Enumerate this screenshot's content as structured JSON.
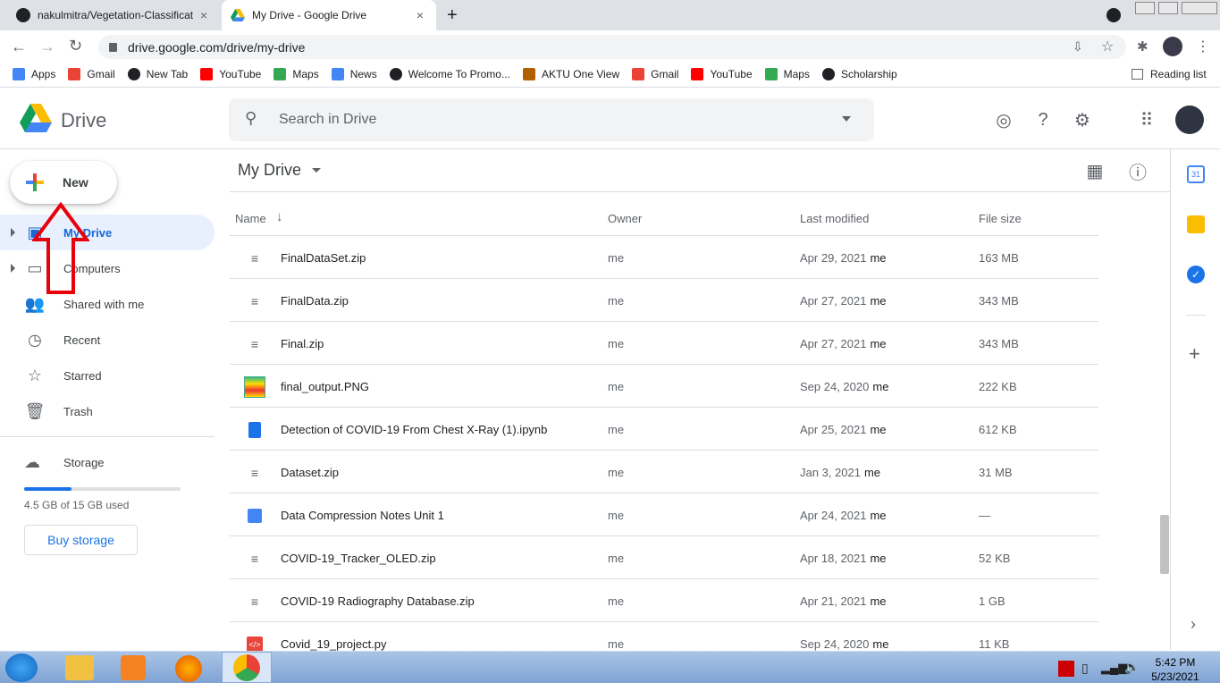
{
  "browser": {
    "tabs": [
      {
        "title": "nakulmitra/Vegetation-Classificat",
        "close": "×"
      },
      {
        "title": "My Drive - Google Drive",
        "close": "×"
      }
    ],
    "new_tab": "+",
    "url": "drive.google.com/drive/my-drive",
    "bookmarks": [
      {
        "label": "Apps",
        "icon": "apps-grid-icon",
        "color": "#4285f4"
      },
      {
        "label": "Gmail",
        "icon": "gmail-icon",
        "color": "#ea4335"
      },
      {
        "label": "New Tab",
        "icon": "globe-icon",
        "color": "#202124"
      },
      {
        "label": "YouTube",
        "icon": "youtube-icon",
        "color": "#ff0000"
      },
      {
        "label": "Maps",
        "icon": "maps-icon",
        "color": "#34a853"
      },
      {
        "label": "News",
        "icon": "news-icon",
        "color": "#4285f4"
      },
      {
        "label": "Welcome To Promo...",
        "icon": "globe-icon",
        "color": "#202124"
      },
      {
        "label": "AKTU One View",
        "icon": "aktu-icon",
        "color": "#b06000"
      },
      {
        "label": "Gmail",
        "icon": "gmail-icon",
        "color": "#ea4335"
      },
      {
        "label": "YouTube",
        "icon": "youtube-icon",
        "color": "#ff0000"
      },
      {
        "label": "Maps",
        "icon": "maps-icon",
        "color": "#34a853"
      },
      {
        "label": "Scholarship",
        "icon": "globe-icon",
        "color": "#202124"
      }
    ],
    "reading_list": "Reading list"
  },
  "drive": {
    "logo_text": "Drive",
    "search_placeholder": "Search in Drive",
    "new_button": "New",
    "nav": [
      {
        "label": "My Drive",
        "icon": "my-drive-icon",
        "active": true
      },
      {
        "label": "Computers",
        "icon": "computers-icon"
      },
      {
        "label": "Shared with me",
        "icon": "shared-icon"
      },
      {
        "label": "Recent",
        "icon": "clock-icon"
      },
      {
        "label": "Starred",
        "icon": "star-icon"
      },
      {
        "label": "Trash",
        "icon": "trash-icon"
      }
    ],
    "storage": {
      "label": "Storage",
      "used_text": "4.5 GB of 15 GB used",
      "used_fraction": 0.3,
      "buy": "Buy storage"
    },
    "title": "My Drive",
    "columns": {
      "name": "Name",
      "owner": "Owner",
      "modified": "Last modified",
      "size": "File size"
    },
    "files": [
      {
        "name": "FinalDataSet.zip",
        "type": "zip",
        "owner": "me",
        "modified": "Apr 29, 2021",
        "by": "me",
        "size": "163 MB"
      },
      {
        "name": "FinalData.zip",
        "type": "zip",
        "owner": "me",
        "modified": "Apr 27, 2021",
        "by": "me",
        "size": "343 MB"
      },
      {
        "name": "Final.zip",
        "type": "zip",
        "owner": "me",
        "modified": "Apr 27, 2021",
        "by": "me",
        "size": "343 MB"
      },
      {
        "name": "final_output.PNG",
        "type": "image",
        "owner": "me",
        "modified": "Sep 24, 2020",
        "by": "me",
        "size": "222 KB"
      },
      {
        "name": "Detection of COVID-19 From Chest X-Ray (1).ipynb",
        "type": "doc",
        "owner": "me",
        "modified": "Apr 25, 2021",
        "by": "me",
        "size": "612 KB"
      },
      {
        "name": "Dataset.zip",
        "type": "zip",
        "owner": "me",
        "modified": "Jan 3, 2021",
        "by": "me",
        "size": "31 MB"
      },
      {
        "name": "Data Compression Notes Unit 1",
        "type": "gdoc",
        "owner": "me",
        "modified": "Apr 24, 2021",
        "by": "me",
        "size": "—"
      },
      {
        "name": "COVID-19_Tracker_OLED.zip",
        "type": "zip",
        "owner": "me",
        "modified": "Apr 18, 2021",
        "by": "me",
        "size": "52 KB"
      },
      {
        "name": "COVID-19 Radiography Database.zip",
        "type": "zip",
        "owner": "me",
        "modified": "Apr 21, 2021",
        "by": "me",
        "size": "1 GB"
      },
      {
        "name": "Covid_19_project.py",
        "type": "code",
        "owner": "me",
        "modified": "Sep 24, 2020",
        "by": "me",
        "size": "11 KB"
      }
    ]
  },
  "taskbar": {
    "time": "5:42 PM",
    "date": "5/23/2021"
  },
  "colors": {
    "accent": "#1a73e8",
    "arrow": "#e8000b"
  }
}
